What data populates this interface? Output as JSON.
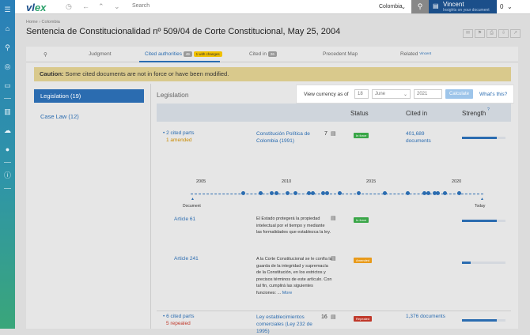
{
  "topbar": {
    "logo_main": "vl",
    "logo_accent": "ex",
    "search_placeholder": "Search",
    "country": "Colombia",
    "user_name": "Vincent",
    "user_sub": "Insights on your document",
    "notif_count": "0"
  },
  "breadcrumb": "Home › Colombia",
  "page_title": "Sentencia de Constitucionalidad nº 509/04 de Corte Constitucional, May 25, 2004",
  "tabs": {
    "judgment": "Judgment",
    "cited_authorities": "Cited authorities",
    "cited_count": "49",
    "cited_changes": "1 with changes",
    "cited_in": "Cited in",
    "cited_in_count": "26",
    "precedent_map": "Precedent Map",
    "related": "Related",
    "related_badge": "Vincent"
  },
  "caution": {
    "label": "Caution:",
    "text": "Some cited documents are not in force or have been modified."
  },
  "left_nav": {
    "legislation": "Legislation (19)",
    "case_law": "Case Law (12)"
  },
  "section_label": "Legislation",
  "currency": {
    "label": "View currency as of",
    "day": "18",
    "month": "June",
    "year": "2021",
    "calculate": "Calculate",
    "whats_this": "What's this?"
  },
  "columns": {
    "status": "Status",
    "cited_in": "Cited in",
    "strength": "Strength"
  },
  "timeline": {
    "years": [
      "2005",
      "2010",
      "2015",
      "2020"
    ],
    "start_label": "Document",
    "end_label": "Today"
  },
  "rows": [
    {
      "parts": "• 2 cited parts",
      "sub": "1 amended",
      "title": "Constitución Política de Colombia (1991)",
      "count": "7",
      "status": "In force",
      "cited_in": "401,689 documents",
      "strength": 0.8
    },
    {
      "parts": "Article 61",
      "text": "El Estado protegerá la propiedad intelectual por el tiempo y mediante las formalidades que establezca la ley.",
      "status": "In force",
      "strength": 0.8
    },
    {
      "parts": "Article 241",
      "text": "A la Corte Constitucional se le confía la guarda de la integridad y supremacía de la Constitución, en los estrictos y precisos términos de este artículo. Con tal fin, cumplirá las siguientes funciones: ...",
      "more": "More",
      "status": "Amended",
      "strength": 0.2
    },
    {
      "parts": "• 6 cited parts",
      "sub": "5 repealed",
      "title": "Ley establecimientos comerciales (Ley 232 de 1995)",
      "count": "16",
      "status": "Repealed",
      "cited_in": "1,376 documents",
      "strength": 0.8
    }
  ],
  "colors": {
    "accent": "#2b6cb0",
    "in_force": "#3aa648",
    "amended": "#e89a1a",
    "repealed": "#c0392b"
  }
}
